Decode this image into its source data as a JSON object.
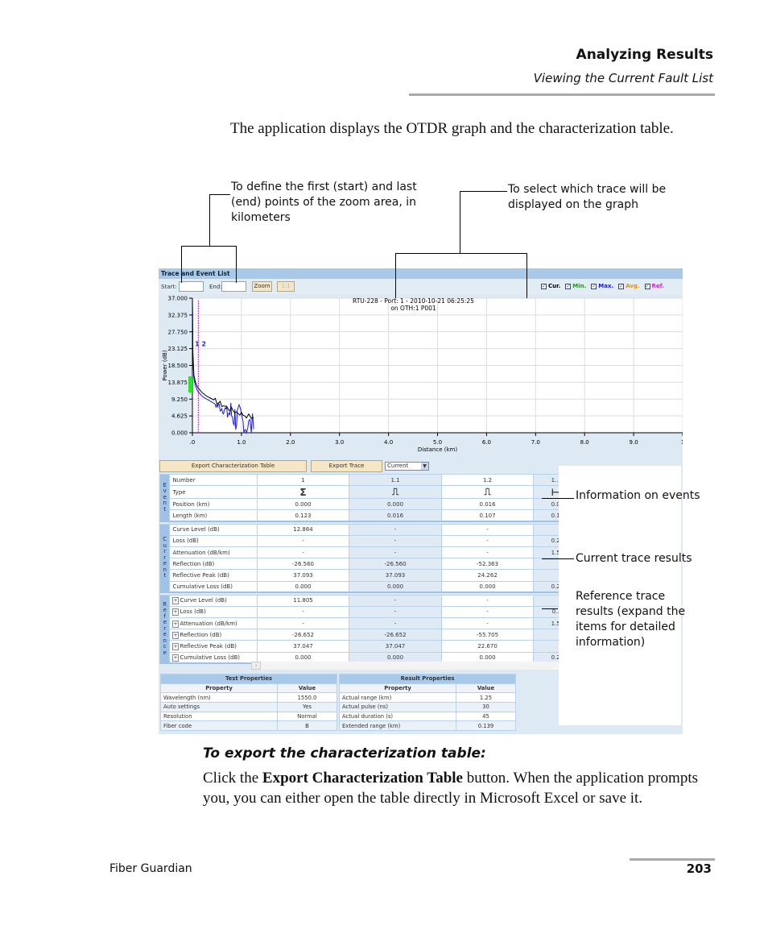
{
  "header": {
    "title": "Analyzing Results",
    "subtitle": "Viewing the Current Fault List"
  },
  "intro": "The application displays the OTDR graph and the characterization table.",
  "callouts": {
    "zoom": "To define the first (start) and last (end) points of the zoom area, in kilometers",
    "traces": "To select which trace will be displayed on the graph",
    "events": "Information on events",
    "current": "Current trace results",
    "reference": "Reference trace results (expand the items for detailed information)"
  },
  "app": {
    "panel_title": "Trace and Event List",
    "start_label": "Start:",
    "start_value": "",
    "end_label": "End:",
    "end_value": "",
    "zoom_button": "Zoom",
    "reset_button": "1:1",
    "trace_checks": [
      {
        "label": "Cur.",
        "color": "#000000",
        "checked": true
      },
      {
        "label": "Min.",
        "color": "#1a9a1a",
        "checked": true
      },
      {
        "label": "Max.",
        "color": "#1a1ae0",
        "checked": true
      },
      {
        "label": "Avg.",
        "color": "#f09000",
        "checked": true
      },
      {
        "label": "Ref.",
        "color": "#e020e0",
        "checked": true
      }
    ],
    "export_table_button": "Export Characterization Table",
    "export_trace_button": "Export Trace",
    "trace_select": "Current",
    "section_labels": {
      "event": "Event",
      "current": "Current",
      "reference": "Reference"
    },
    "event_rows": [
      {
        "label": "Number",
        "values": [
          "1",
          "1.1",
          "1.2",
          "1..."
        ]
      },
      {
        "label": "Type",
        "values": [
          "Σ",
          "⎍",
          "⎍",
          "⊢"
        ]
      },
      {
        "label": "Position (km)",
        "values": [
          "0.000",
          "0.000",
          "0.016",
          "0.0"
        ]
      },
      {
        "label": "Length (km)",
        "values": [
          "0.123",
          "0.016",
          "0.107",
          "0.1"
        ]
      }
    ],
    "current_rows": [
      {
        "label": "Curve Level (dB)",
        "values": [
          "12.864",
          "-",
          "-",
          ""
        ]
      },
      {
        "label": "Loss (dB)",
        "values": [
          "-",
          "-",
          "-",
          "0.2"
        ]
      },
      {
        "label": "Attenuation (dB/km)",
        "values": [
          "-",
          "-",
          "-",
          "1.5"
        ]
      },
      {
        "label": "Reflection (dB)",
        "values": [
          "-26.560",
          "-26.560",
          "-52.363",
          ""
        ]
      },
      {
        "label": "Reflective Peak (dB)",
        "values": [
          "37.093",
          "37.093",
          "24.262",
          ""
        ]
      },
      {
        "label": "Cumulative Loss (dB)",
        "values": [
          "0.000",
          "0.000",
          "0.000",
          "0.2"
        ]
      }
    ],
    "reference_rows": [
      {
        "label": "Curve Level (dB)",
        "values": [
          "11.805",
          "-",
          "-",
          ""
        ]
      },
      {
        "label": "Loss (dB)",
        "values": [
          "-",
          "-",
          "-",
          "0.."
        ]
      },
      {
        "label": "Attenuation (dB/km)",
        "values": [
          "-",
          "-",
          "-",
          "1.5"
        ]
      },
      {
        "label": "Reflection (dB)",
        "values": [
          "-26.652",
          "-26.652",
          "-55.705",
          ""
        ]
      },
      {
        "label": "Reflective Peak (dB)",
        "values": [
          "37.047",
          "37.047",
          "22.670",
          ""
        ]
      },
      {
        "label": "Cumulative Loss (dB)",
        "values": [
          "0.000",
          "0.000",
          "0.000",
          "0.2"
        ]
      }
    ],
    "test_properties": {
      "title": "Test Properties",
      "headers": [
        "Property",
        "Value"
      ],
      "rows": [
        [
          "Wavelength (nm)",
          "1550.0"
        ],
        [
          "Auto settings",
          "Yes"
        ],
        [
          "Resolution",
          "Normal"
        ],
        [
          "Fiber code",
          "B"
        ]
      ]
    },
    "result_properties": {
      "title": "Result Properties",
      "headers": [
        "Property",
        "Value"
      ],
      "rows": [
        [
          "Actual range (km)",
          "1.25"
        ],
        [
          "Actual pulse (ns)",
          "30"
        ],
        [
          "Actual duration (s)",
          "45"
        ],
        [
          "Extended range (km)",
          "0.139"
        ]
      ]
    }
  },
  "chart_data": {
    "type": "line",
    "title": "RTU-228 - Port: 1 - 2010-10-21 06:25:25",
    "subtitle": "on OTH:1 P001",
    "xlabel": "Distance (km)",
    "ylabel": "Power (dB)",
    "xlim": [
      0,
      10
    ],
    "ylim": [
      0,
      37
    ],
    "xticks": [
      ".0",
      "1.0",
      "2.0",
      "3.0",
      "4.0",
      "5.0",
      "6.0",
      "7.0",
      "8.0",
      "9.0",
      "1"
    ],
    "yticks": [
      "37.000",
      "32.375",
      "27.750",
      "23.125",
      "18.500",
      "13.875",
      "9.250",
      "4.625",
      "0.000"
    ],
    "grid": true,
    "markers": [
      {
        "label": "1",
        "x": 0.0
      },
      {
        "label": "2",
        "x": 0.12
      }
    ],
    "series": [
      {
        "color": "#000000",
        "x": [
          0,
          0.01,
          0.03,
          0.06,
          0.1,
          0.2,
          0.3,
          0.4,
          0.5,
          0.6,
          0.7,
          0.8,
          0.9,
          1.0,
          1.1,
          1.25
        ],
        "y": [
          37,
          22,
          16,
          14,
          12.6,
          11,
          10,
          9.3,
          8.5,
          7.7,
          7,
          6.2,
          5.7,
          5.2,
          4.7,
          4.2
        ]
      },
      {
        "color": "#1a1ae0",
        "x": [
          0,
          0.01,
          0.03,
          0.06,
          0.1,
          0.2,
          0.3,
          0.4,
          0.5,
          0.6,
          0.7,
          0.8,
          0.9,
          1.0,
          1.1,
          1.25
        ],
        "y": [
          37,
          21,
          15,
          13,
          11.6,
          10,
          9.2,
          8.4,
          7.6,
          6.8,
          6,
          5,
          4,
          3,
          2,
          1
        ]
      }
    ]
  },
  "export_heading": "To export the characterization table:",
  "export_text": {
    "pre": "Click the ",
    "bold": "Export Characterization Table",
    "post": " button. When the application prompts you, you can either open the table directly in Microsoft Excel or save it."
  },
  "footer": {
    "left": "Fiber Guardian",
    "page": "203"
  }
}
